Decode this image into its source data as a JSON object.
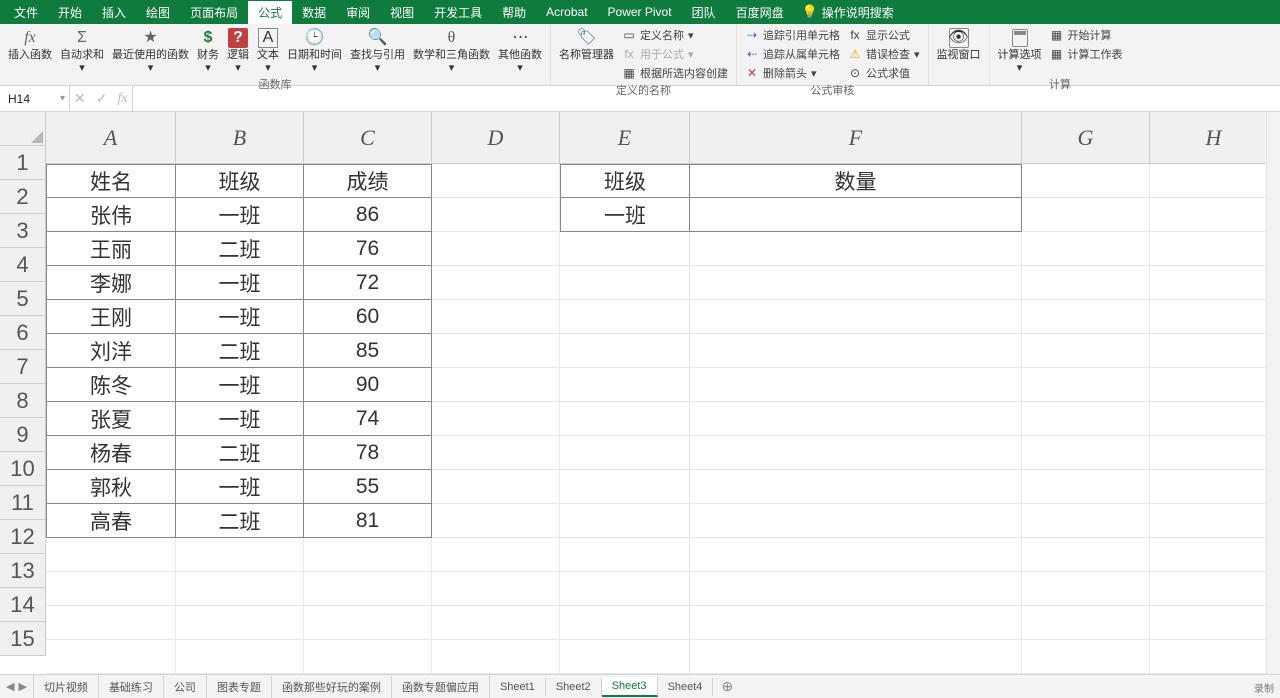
{
  "tabs": {
    "file": "文件",
    "home": "开始",
    "insert": "插入",
    "draw": "绘图",
    "pagelayout": "页面布局",
    "formulas": "公式",
    "data": "数据",
    "review": "审阅",
    "view": "视图",
    "dev": "开发工具",
    "help": "帮助",
    "acrobat": "Acrobat",
    "powerpivot": "Power Pivot",
    "team": "团队",
    "netdisk": "百度网盘",
    "search": "操作说明搜索"
  },
  "ribbon": {
    "insertfn": "插入函数",
    "autosum": "自动求和",
    "recent": "最近使用的函数",
    "financial": "财务",
    "logical": "逻辑",
    "text": "文本",
    "datetime": "日期和时间",
    "lookup": "查找与引用",
    "math": "数学和三角函数",
    "more": "其他函数",
    "group_lib": "函数库",
    "namemgr": "名称管理器",
    "define_name": "定义名称",
    "use_in_formula": "用于公式",
    "create_from_sel": "根据所选内容创建",
    "group_names": "定义的名称",
    "trace_prec": "追踪引用单元格",
    "trace_dep": "追踪从属单元格",
    "remove_arrows": "删除箭头",
    "show_formulas": "显示公式",
    "error_check": "错误检查",
    "eval_formula": "公式求值",
    "group_audit": "公式审核",
    "watch": "监视窗口",
    "calc_opts": "计算选项",
    "calc_now": "开始计算",
    "calc_sheet": "计算工作表",
    "group_calc": "计算"
  },
  "namebox": "H14",
  "headers": {
    "A": "A",
    "B": "B",
    "C": "C",
    "D": "D",
    "E": "E",
    "F": "F",
    "G": "G",
    "H": "H"
  },
  "rows": [
    "1",
    "2",
    "3",
    "4",
    "5",
    "6",
    "7",
    "8",
    "9",
    "10",
    "11",
    "12",
    "13",
    "14",
    "15"
  ],
  "table1": {
    "h1": "姓名",
    "h2": "班级",
    "h3": "成绩",
    "r": [
      {
        "a": "张伟",
        "b": "一班",
        "c": "86"
      },
      {
        "a": "王丽",
        "b": "二班",
        "c": "76"
      },
      {
        "a": "李娜",
        "b": "一班",
        "c": "72"
      },
      {
        "a": "王刚",
        "b": "一班",
        "c": "60"
      },
      {
        "a": "刘洋",
        "b": "二班",
        "c": "85"
      },
      {
        "a": "陈冬",
        "b": "一班",
        "c": "90"
      },
      {
        "a": "张夏",
        "b": "一班",
        "c": "74"
      },
      {
        "a": "杨春",
        "b": "二班",
        "c": "78"
      },
      {
        "a": "郭秋",
        "b": "一班",
        "c": "55"
      },
      {
        "a": "高春",
        "b": "二班",
        "c": "81"
      }
    ]
  },
  "table2": {
    "h1": "班级",
    "h2": "数量",
    "v1": "一班"
  },
  "sheets": {
    "s1": "切片视频",
    "s2": "基础练习",
    "s3": "公司",
    "s4": "图表专题",
    "s5": "函数那些好玩的案例",
    "s6": "函数专题偏应用",
    "s7": "Sheet1",
    "s8": "Sheet2",
    "s9": "Sheet3",
    "s10": "Sheet4"
  },
  "status_rec": "录制"
}
